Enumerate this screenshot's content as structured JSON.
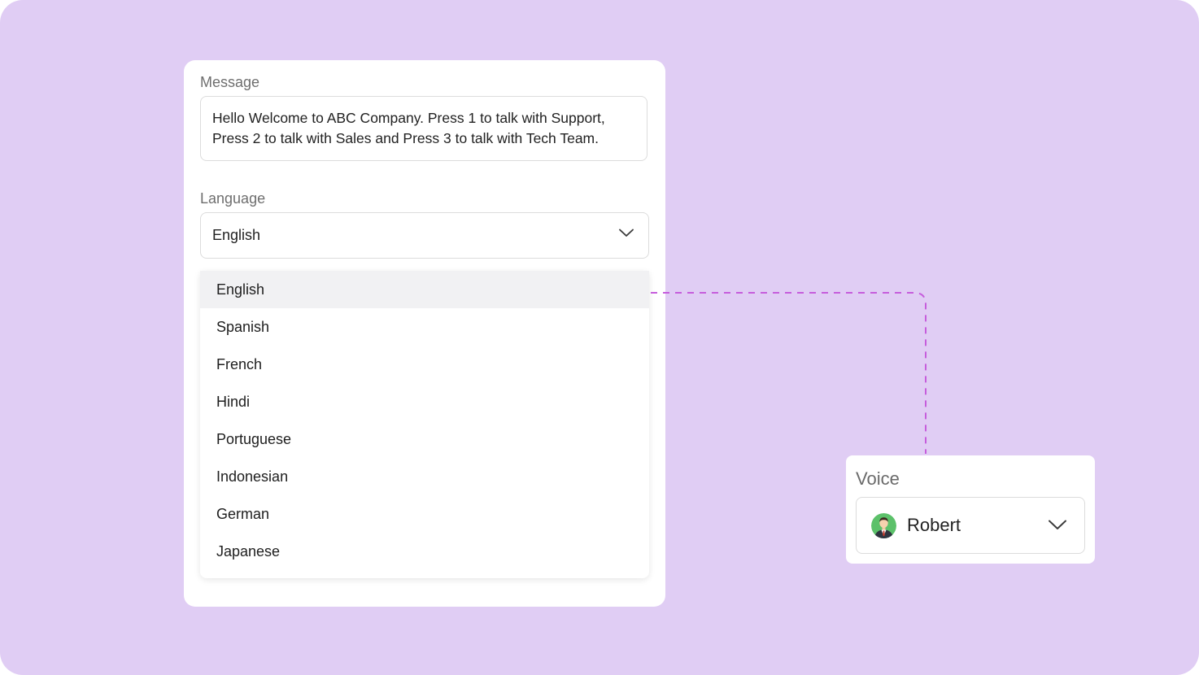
{
  "message": {
    "label": "Message",
    "text": "Hello Welcome to ABC Company. Press 1 to talk with Support, Press 2 to talk with Sales and Press 3 to talk with Tech Team."
  },
  "language": {
    "label": "Language",
    "selected": "English",
    "options": [
      "English",
      "Spanish",
      "French",
      "Hindi",
      "Portuguese",
      "Indonesian",
      "German",
      "Japanese"
    ]
  },
  "voice": {
    "label": "Voice",
    "selected": "Robert",
    "avatar_icon": "person-avatar-icon"
  },
  "colors": {
    "background": "#e0cdf4",
    "connector": "#c65ddc",
    "selected_option": "#f1f1f3"
  }
}
